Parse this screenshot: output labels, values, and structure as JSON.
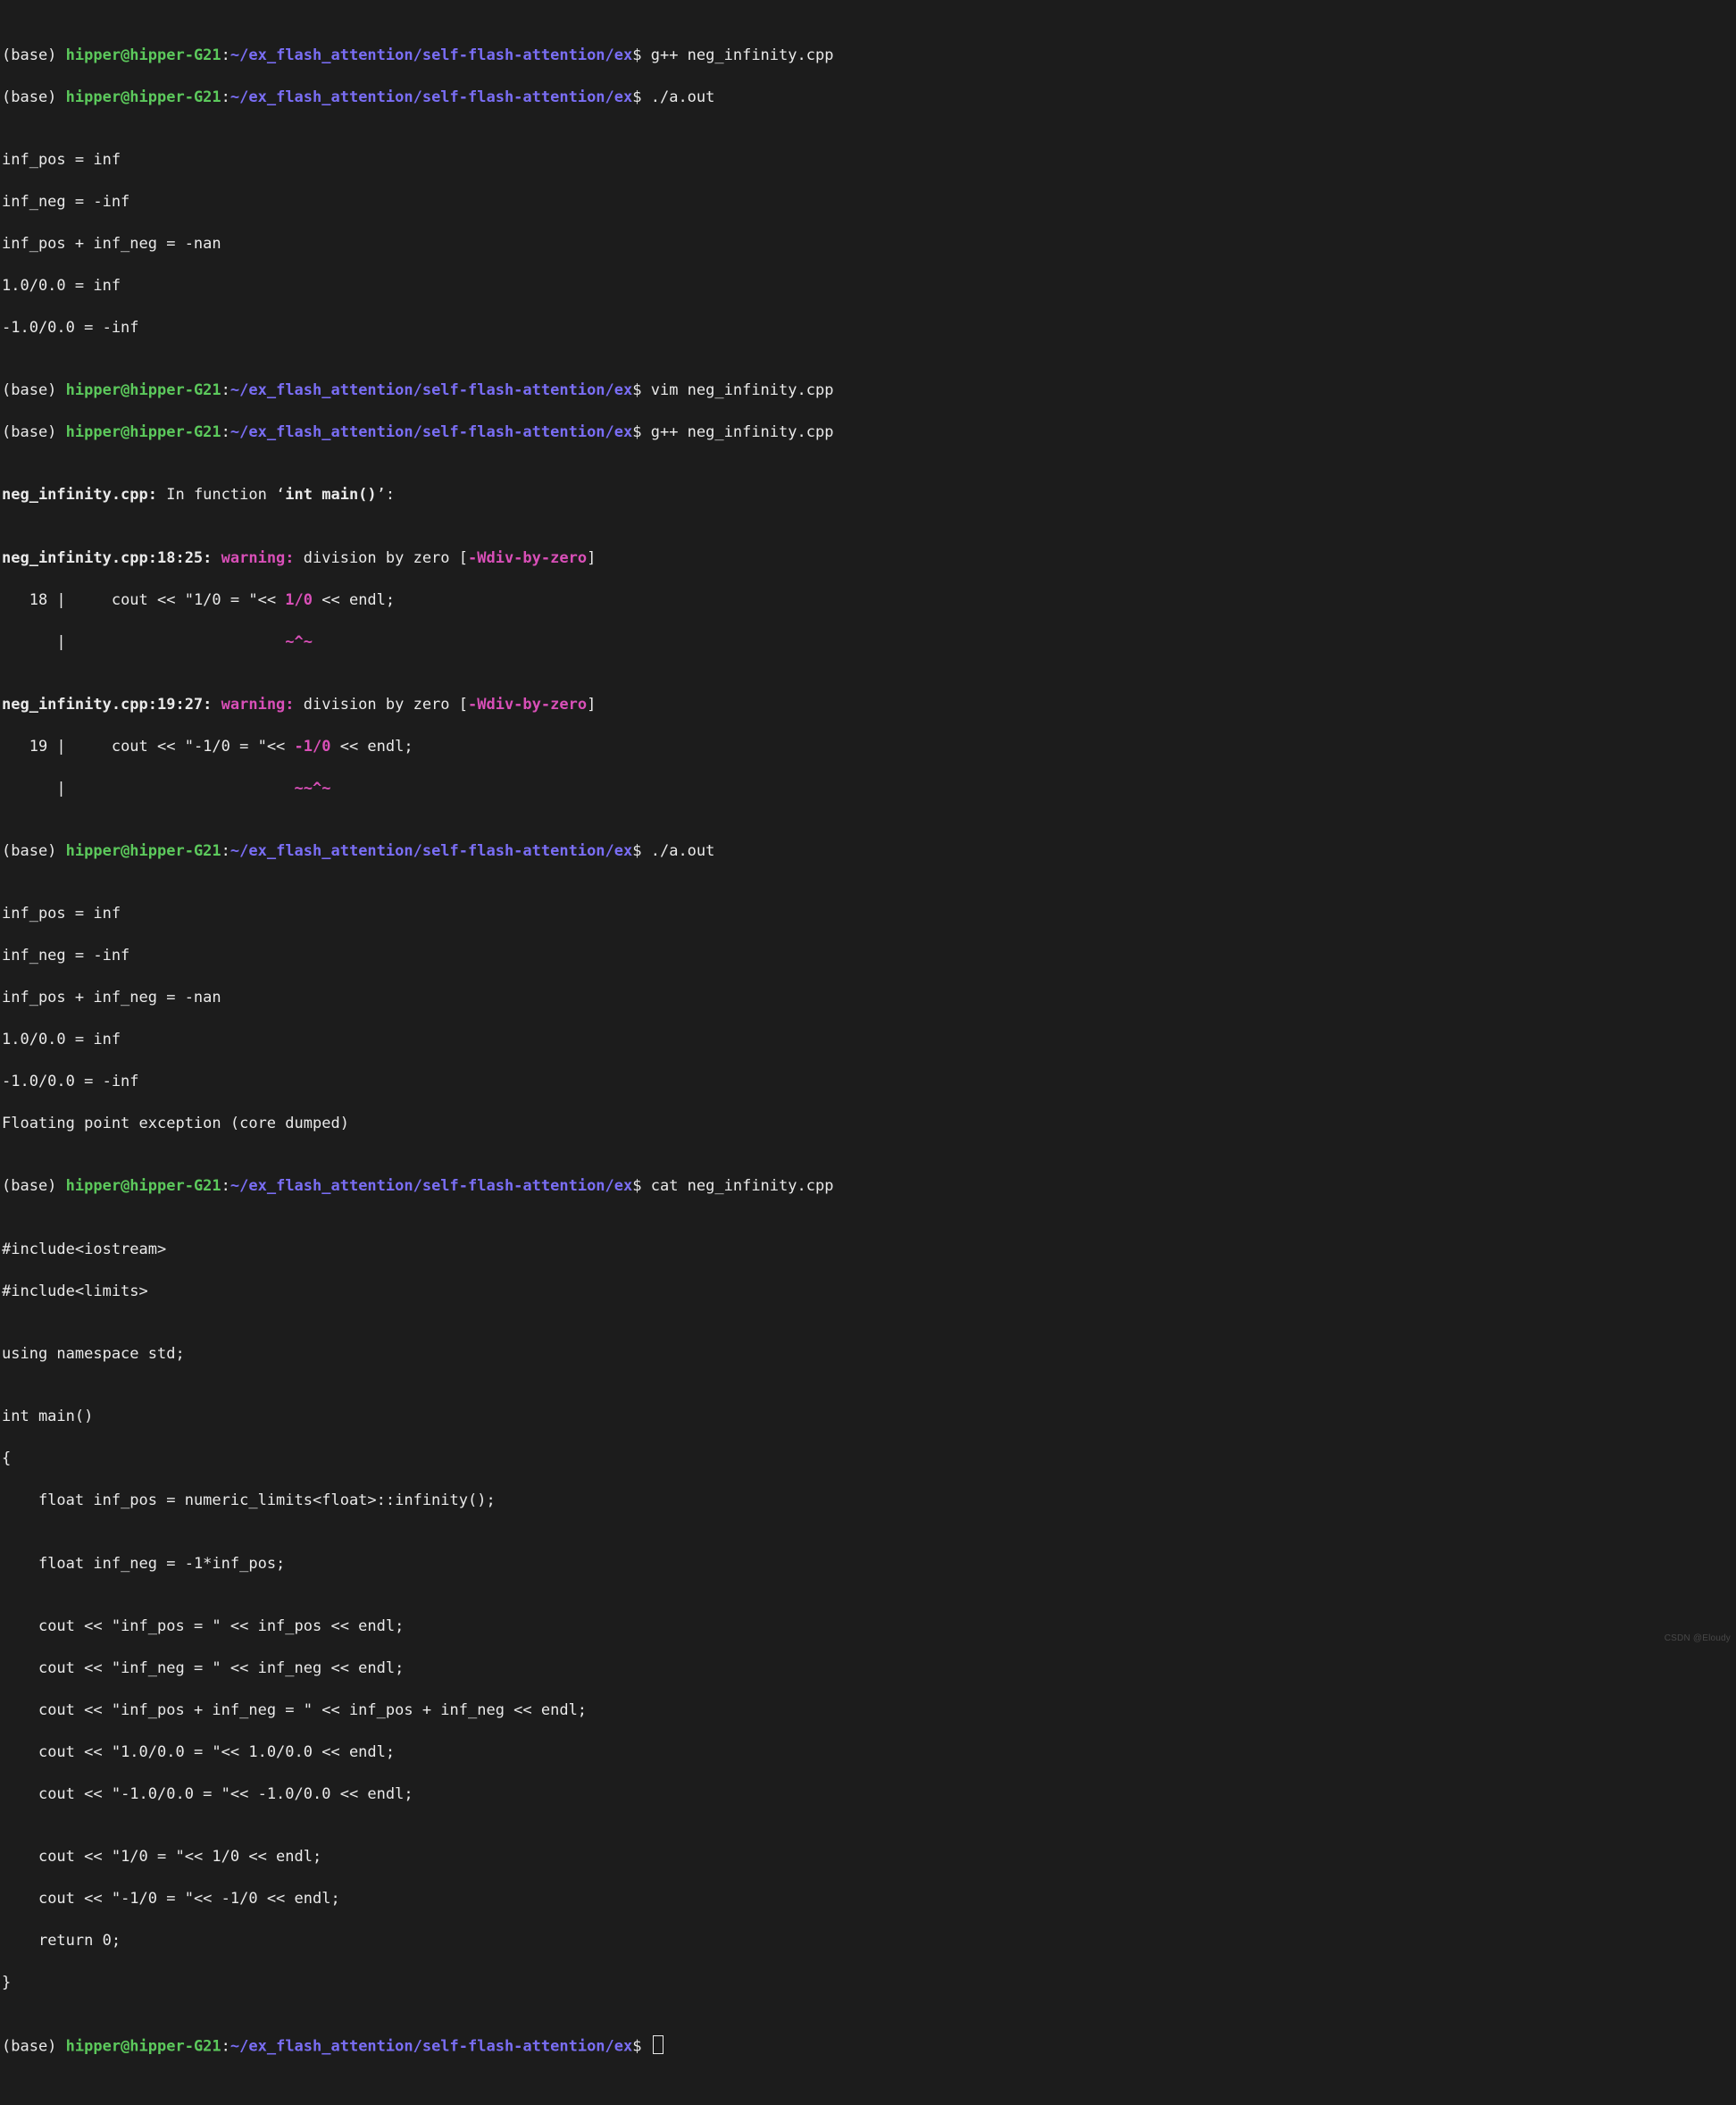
{
  "prompt": {
    "env": "(base) ",
    "user": "hipper@hipper-G21",
    "colon": ":",
    "path": "~/ex_flash_attention/self-flash-attention/ex",
    "dollar": "$ "
  },
  "commands": {
    "l0": "g++ neg_infinity.cpp",
    "l1": "./a.out",
    "l7": "vim neg_infinity.cpp",
    "l8": "g++ neg_infinity.cpp",
    "l17": "./a.out",
    "l24": "cat neg_infinity.cpp"
  },
  "out_first": {
    "o0": "inf_pos = inf",
    "o1": "inf_neg = -inf",
    "o2": "inf_pos + inf_neg = -nan",
    "o3": "1.0/0.0 = inf",
    "o4": "-1.0/0.0 = -inf"
  },
  "compile_warn": {
    "file_func_a": "neg_infinity.cpp:",
    "file_func_b": " In function ‘",
    "file_func_c": "int main()",
    "file_func_d": "’:",
    "w1_loc": "neg_infinity.cpp:18:25: ",
    "warning_label": "warning:",
    "w1_msg_a": " division by zero [",
    "w1_flag": "-Wdiv-by-zero",
    "w1_msg_b": "]",
    "w1_code_a": "   18 |     cout << \"1/0 = \"<< ",
    "w1_code_hl": "1/0",
    "w1_code_b": " << endl;",
    "w1_caret_pad": "      |                        ",
    "w1_caret": "~^~",
    "w2_loc": "neg_infinity.cpp:19:27: ",
    "w2_msg_a": " division by zero [",
    "w2_flag": "-Wdiv-by-zero",
    "w2_msg_b": "]",
    "w2_code_a": "   19 |     cout << \"-1/0 = \"<< ",
    "w2_code_hl": "-1/0",
    "w2_code_b": " << endl;",
    "w2_caret_pad": "      |                         ",
    "w2_caret": "~~^~"
  },
  "out_second": {
    "o0": "inf_pos = inf",
    "o1": "inf_neg = -inf",
    "o2": "inf_pos + inf_neg = -nan",
    "o3": "1.0/0.0 = inf",
    "o4": "-1.0/0.0 = -inf",
    "o5": "Floating point exception (core dumped)"
  },
  "source": {
    "s0": "#include<iostream>",
    "s1": "#include<limits>",
    "s2": "",
    "s3": "using namespace std;",
    "s4": "",
    "s5": "int main()",
    "s6": "{",
    "s7": "    float inf_pos = numeric_limits<float>::infinity();",
    "s8": "",
    "s9": "    float inf_neg = -1*inf_pos;",
    "s10": "",
    "s11": "    cout << \"inf_pos = \" << inf_pos << endl;",
    "s12": "    cout << \"inf_neg = \" << inf_neg << endl;",
    "s13": "    cout << \"inf_pos + inf_neg = \" << inf_pos + inf_neg << endl;",
    "s14": "    cout << \"1.0/0.0 = \"<< 1.0/0.0 << endl;",
    "s15": "    cout << \"-1.0/0.0 = \"<< -1.0/0.0 << endl;",
    "s16": "",
    "s17": "    cout << \"1/0 = \"<< 1/0 << endl;",
    "s18": "    cout << \"-1/0 = \"<< -1/0 << endl;",
    "s19": "    return 0;",
    "s20": "}"
  },
  "watermark": "CSDN @Eloudy"
}
